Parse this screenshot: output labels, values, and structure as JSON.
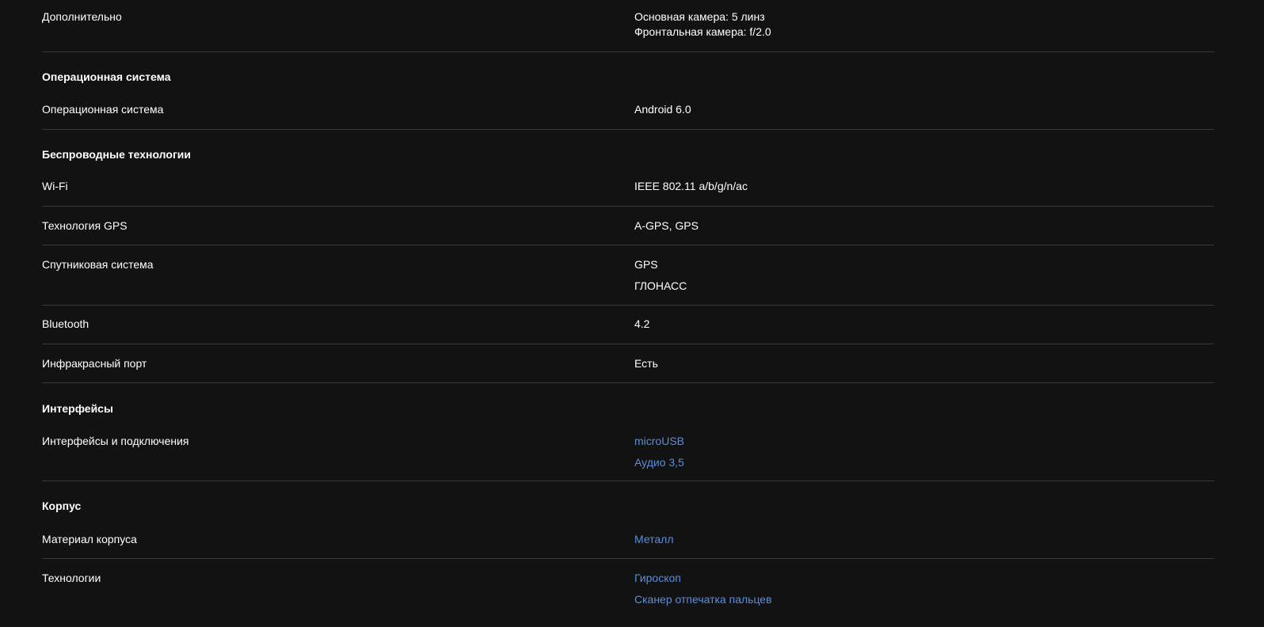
{
  "extra": {
    "label": "Дополнительно",
    "value_1": "Основная камера: 5 линз",
    "value_2": "Фронтальная камера: f/2.0"
  },
  "os_section": {
    "heading": "Операционная система",
    "os_label": "Операционная система",
    "os_value": "Android 6.0"
  },
  "wireless_section": {
    "heading": "Беспроводные технологии",
    "wifi_label": "Wi-Fi",
    "wifi_value": "IEEE 802.11 a/b/g/n/ac",
    "gps_label": "Технология GPS",
    "gps_value": "A-GPS, GPS",
    "sat_label": "Спутниковая система",
    "sat_values": [
      "GPS",
      "ГЛОНАСС"
    ],
    "bt_label": "Bluetooth",
    "bt_value": "4.2",
    "ir_label": "Инфракрасный порт",
    "ir_value": "Есть"
  },
  "interfaces_section": {
    "heading": "Интерфейсы",
    "label": "Интерфейсы и подключения",
    "links": [
      "microUSB",
      "Аудио 3,5"
    ]
  },
  "body_section": {
    "heading": "Корпус",
    "material_label": "Материал корпуса",
    "material_link": "Металл",
    "tech_label": "Технологии",
    "tech_links": [
      "Гироскоп",
      "Сканер отпечатка пальцев"
    ]
  },
  "colors": {
    "background": "#121212",
    "text": "#ffffff",
    "link": "#5b8dd9",
    "divider": "#3a3a3a"
  }
}
